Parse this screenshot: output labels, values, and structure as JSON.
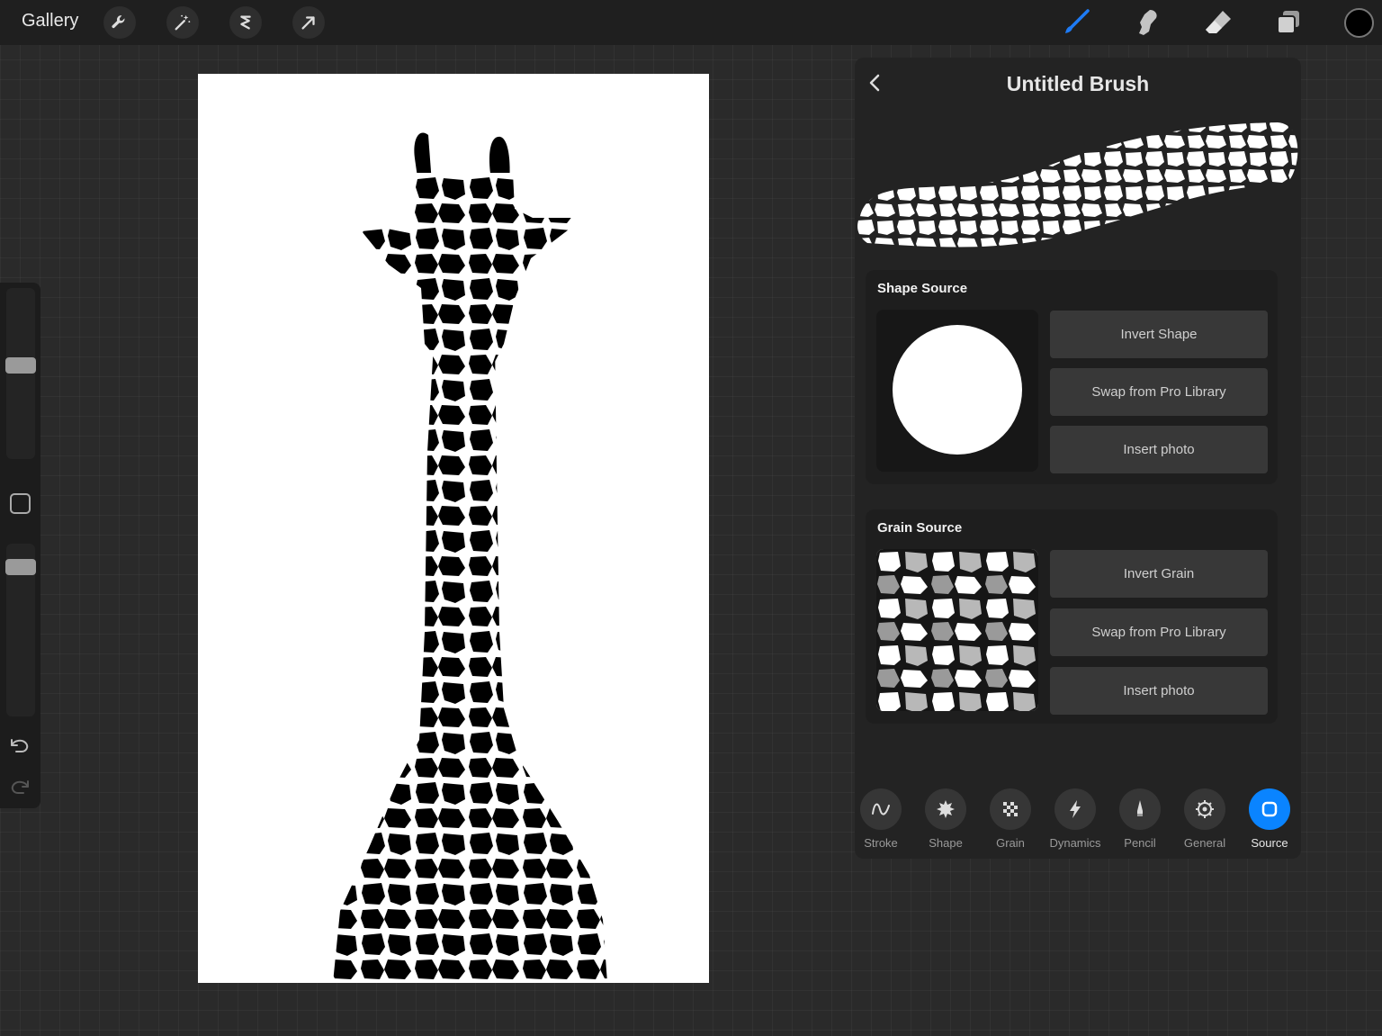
{
  "topbar": {
    "gallery_label": "Gallery",
    "tools": [
      "wrench-icon",
      "magic-wand-icon",
      "selection-icon",
      "transform-arrow-icon"
    ],
    "right_tools": [
      "paintbrush-icon",
      "smudge-icon",
      "eraser-icon",
      "layers-icon"
    ],
    "active_tool": "paintbrush-icon",
    "active_color": "#000000",
    "accent_color": "#0a84ff"
  },
  "sidebar": {
    "brush_size_level": 0.55,
    "opacity_level": 0.9
  },
  "brush_panel": {
    "title": "Untitled Brush",
    "shape_source": {
      "title": "Shape Source",
      "buttons": [
        "Invert Shape",
        "Swap from Pro Library",
        "Insert photo"
      ]
    },
    "grain_source": {
      "title": "Grain Source",
      "buttons": [
        "Invert Grain",
        "Swap from Pro Library",
        "Insert photo"
      ]
    },
    "tabs": [
      {
        "label": "Stroke",
        "icon": "stroke-wave-icon"
      },
      {
        "label": "Shape",
        "icon": "shape-star-icon"
      },
      {
        "label": "Grain",
        "icon": "grain-checker-icon"
      },
      {
        "label": "Dynamics",
        "icon": "lightning-icon"
      },
      {
        "label": "Pencil",
        "icon": "pencil-tip-icon"
      },
      {
        "label": "General",
        "icon": "gear-icon"
      },
      {
        "label": "Source",
        "icon": "source-square-icon"
      }
    ],
    "active_tab": "Source"
  }
}
